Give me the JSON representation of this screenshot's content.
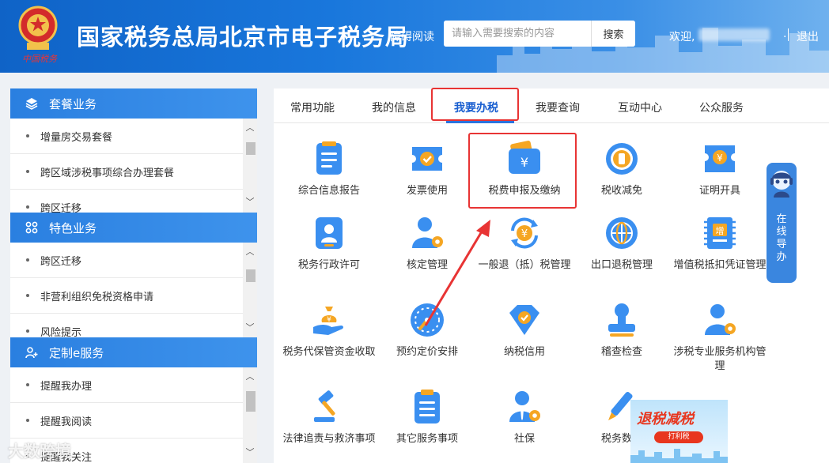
{
  "header": {
    "emblem_text": "中国税务",
    "title": "国家税务总局北京市电子税务局",
    "barrier_free": "障碍阅读",
    "search_placeholder": "请输入需要搜索的内容",
    "search_button": "搜索",
    "welcome": "欢迎,",
    "dot": ".",
    "logout": "退出"
  },
  "sidebar": {
    "sections": [
      {
        "title": "套餐业务",
        "icon": "layers-icon",
        "items": [
          "增量房交易套餐",
          "跨区域涉税事项综合办理套餐",
          "跨区迁移"
        ]
      },
      {
        "title": "特色业务",
        "icon": "grid-icon",
        "items": [
          "跨区迁移",
          "非营利组织免税资格申请",
          "风险提示"
        ]
      },
      {
        "title": "定制e服务",
        "icon": "user-plus-icon",
        "items": [
          "提醒我办理",
          "提醒我阅读",
          "提醒我关注"
        ]
      }
    ]
  },
  "tabs": [
    "常用功能",
    "我的信息",
    "我要办税",
    "我要查询",
    "互动中心",
    "公众服务"
  ],
  "active_tab": "我要办税",
  "tiles": [
    {
      "label": "综合信息报告",
      "icon": "document-report-icon"
    },
    {
      "label": "发票使用",
      "icon": "invoice-ticket-icon"
    },
    {
      "label": "税费申报及缴纳",
      "icon": "wallet-yuan-icon"
    },
    {
      "label": "税收减免",
      "icon": "tax-relief-coin-icon"
    },
    {
      "label": "证明开具",
      "icon": "certificate-yuan-icon"
    },
    {
      "label": "税务行政许可",
      "icon": "permit-badge-icon"
    },
    {
      "label": "核定管理",
      "icon": "user-gear-icon"
    },
    {
      "label": "一般退（抵）税管理",
      "icon": "yuan-refresh-icon"
    },
    {
      "label": "出口退税管理",
      "icon": "globe-icon"
    },
    {
      "label": "增值税抵扣凭证管理",
      "icon": "vat-ticket-icon"
    },
    {
      "label": "税务代保管资金收取",
      "icon": "money-bag-hand-icon"
    },
    {
      "label": "预约定价安排",
      "icon": "gauge-icon"
    },
    {
      "label": "纳税信用",
      "icon": "diamond-check-icon"
    },
    {
      "label": "稽查检查",
      "icon": "stamp-icon"
    },
    {
      "label": "涉税专业服务机构管理",
      "icon": "user-gear-icon"
    },
    {
      "label": "法律追责与救济事项",
      "icon": "gavel-icon"
    },
    {
      "label": "其它服务事项",
      "icon": "clipboard-list-icon"
    },
    {
      "label": "社保",
      "icon": "user-tie-gear-icon"
    },
    {
      "label": "税务数字",
      "icon": "pen-icon"
    }
  ],
  "assistant": {
    "label": "在线导办",
    "icon": "robot-assistant-icon"
  },
  "promo": {
    "title": "退税减税",
    "subtitle": "打利税"
  },
  "watermark": "大数跨境",
  "colors": {
    "primary": "#1a73d9",
    "highlight": "#e83434",
    "icon_blue": "#3a8ff0",
    "icon_orange": "#f5a623"
  }
}
